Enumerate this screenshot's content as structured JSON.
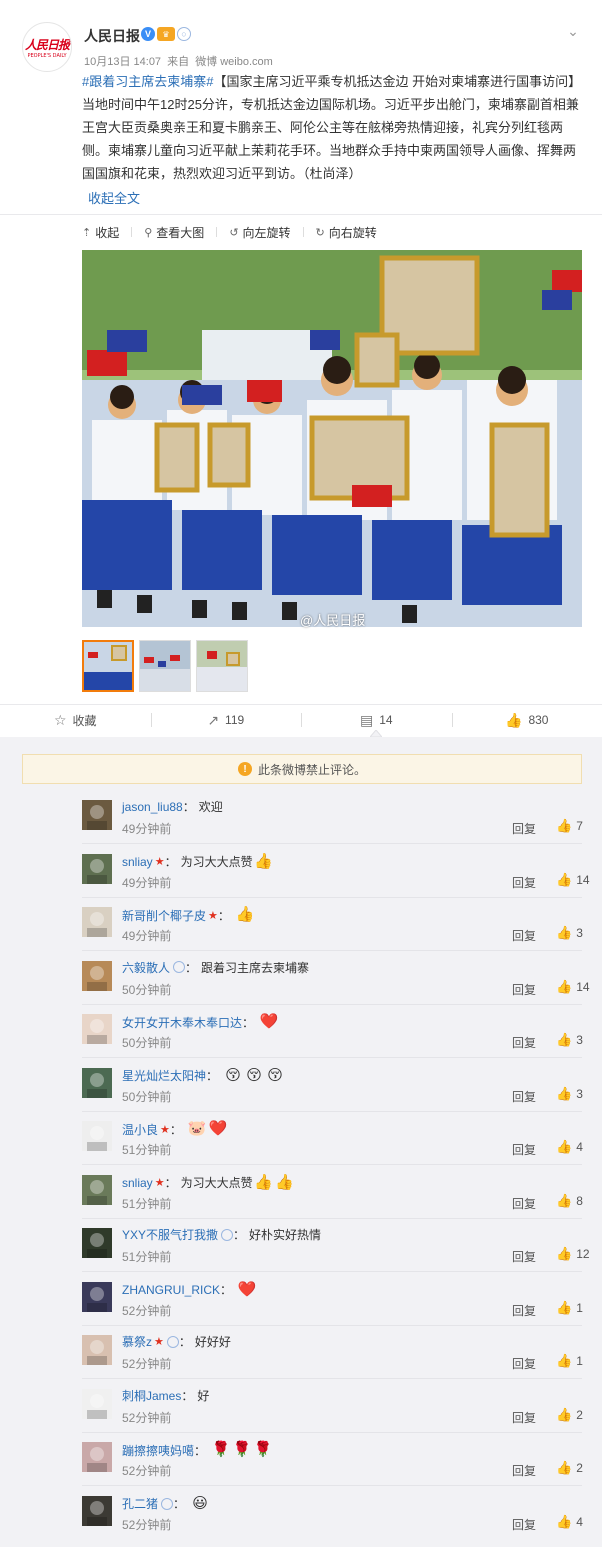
{
  "post": {
    "author": "人民日报",
    "date": "10月13日 14:07",
    "source_prefix": "来自",
    "source": "微博 weibo.com",
    "topic": "#跟着习主席去柬埔寨#",
    "body": "【国家主席习近平乘专机抵达金边 开始对柬埔寨进行国事访问】当地时间中午12时25分许，专机抵达金边国际机场。习近平步出舱门，柬埔寨副首相兼王宫大臣贡桑奥亲王和夏卡鹏亲王、阿伦公主等在舷梯旁热情迎接，礼宾分列红毯两侧。柬埔寨儿童向习近平献上茉莉花手环。当地群众手持中柬两国领导人画像、挥舞两国国旗和花束，热烈欢迎习近平到访。（杜尚泽）",
    "collapse_label": "收起全文",
    "logo_text": "人民日报",
    "logo_sub": "PEOPLE'S DAILY"
  },
  "tools": {
    "collapse": "收起",
    "view_large": "查看大图",
    "rotate_left": "向左旋转",
    "rotate_right": "向右旋转"
  },
  "photo": {
    "watermark": "@人民日报"
  },
  "actions": {
    "favorite": "收藏",
    "repost": "119",
    "comment": "14",
    "like": "830"
  },
  "notice": "此条微博禁止评论。",
  "comments": [
    {
      "user": "jason_liu88",
      "text": "欢迎",
      "time": "49分钟前",
      "reply": "回复",
      "likes": "7"
    },
    {
      "user": "snliay",
      "text": "为习大大点赞",
      "time": "49分钟前",
      "reply": "回复",
      "likes": "14"
    },
    {
      "user": "新哥削个椰子皮",
      "text": "",
      "time": "49分钟前",
      "reply": "回复",
      "likes": "3"
    },
    {
      "user": "六毅散人",
      "text": "跟着习主席去柬埔寨",
      "time": "50分钟前",
      "reply": "回复",
      "likes": "14"
    },
    {
      "user": "女开女开木奉木奉口达",
      "text": "",
      "time": "50分钟前",
      "reply": "回复",
      "likes": "3"
    },
    {
      "user": "星光灿烂太阳神",
      "text": "",
      "time": "50分钟前",
      "reply": "回复",
      "likes": "3"
    },
    {
      "user": "温小良",
      "text": "",
      "time": "51分钟前",
      "reply": "回复",
      "likes": "4"
    },
    {
      "user": "snliay",
      "text": "为习大大点赞",
      "time": "51分钟前",
      "reply": "回复",
      "likes": "8"
    },
    {
      "user": "YXY不服气打我撒",
      "text": "好朴实好热情",
      "time": "51分钟前",
      "reply": "回复",
      "likes": "12"
    },
    {
      "user": "ZHANGRUI_RICK",
      "text": "",
      "time": "52分钟前",
      "reply": "回复",
      "likes": "1"
    },
    {
      "user": "慕祭z",
      "text": "好好好",
      "time": "52分钟前",
      "reply": "回复",
      "likes": "1"
    },
    {
      "user": "刺桐James",
      "text": "好",
      "time": "52分钟前",
      "reply": "回复",
      "likes": "2"
    },
    {
      "user": "蹦擦擦咦妈噶",
      "text": "",
      "time": "52分钟前",
      "reply": "回复",
      "likes": "2"
    },
    {
      "user": "孔二猪",
      "text": "",
      "time": "52分钟前",
      "reply": "回复",
      "likes": "4"
    }
  ],
  "colors": {
    "link": "#2c6fb6",
    "accent": "#f27c0c",
    "star": "#e0301e"
  },
  "icons": [
    "chevron-down-icon",
    "verified-icon",
    "vip-icon",
    "ring-icon",
    "star-icon",
    "like-icon",
    "comment-icon",
    "repost-icon",
    "favorite-icon",
    "warning-icon"
  ]
}
